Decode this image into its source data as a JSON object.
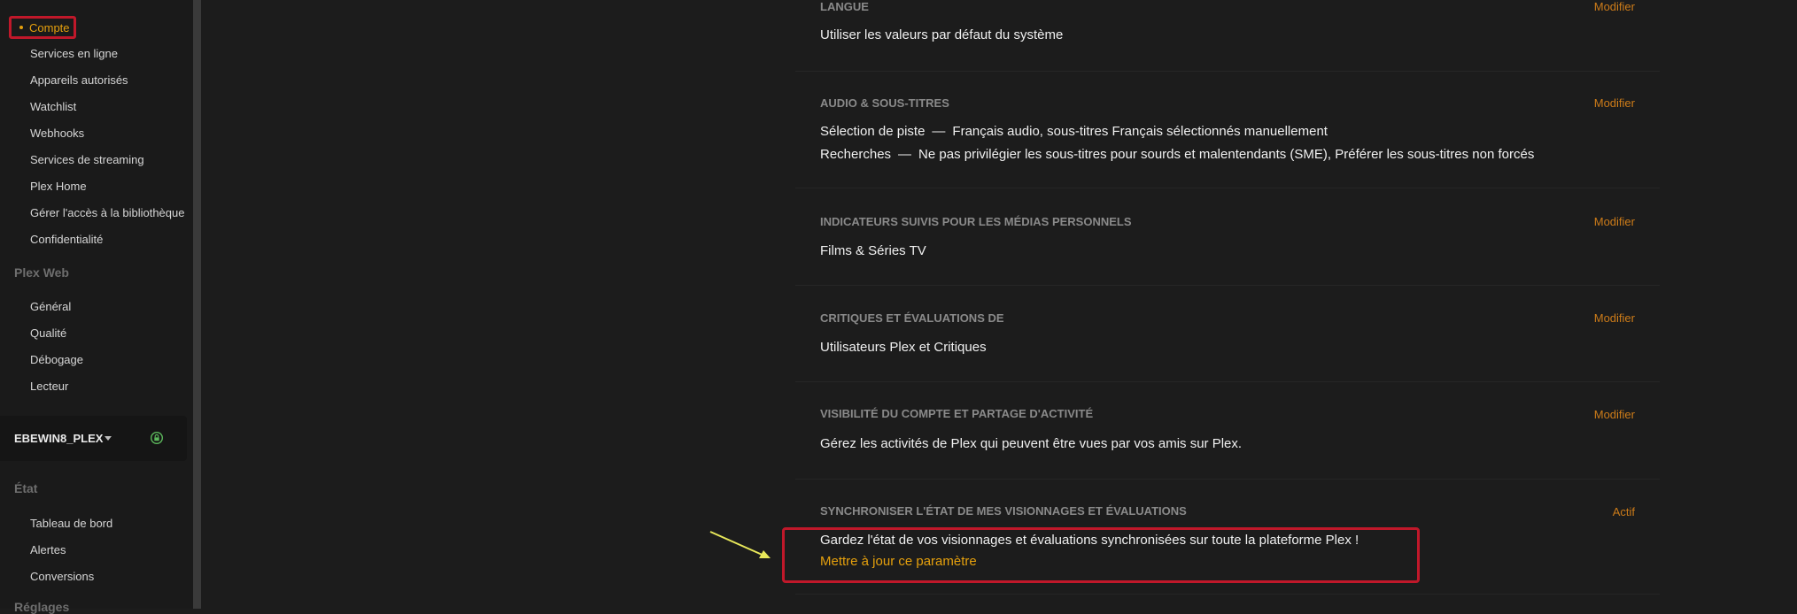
{
  "sidebar": {
    "active_item": "Compte",
    "account_items": [
      "Services en ligne",
      "Appareils autorisés",
      "Watchlist",
      "Webhooks",
      "Services de streaming",
      "Plex Home",
      "Gérer l'accès à la bibliothèque",
      "Confidentialité"
    ],
    "plex_web_heading": "Plex Web",
    "plex_web_items": [
      "Général",
      "Qualité",
      "Débogage",
      "Lecteur"
    ],
    "server_name": "EBEWIN8_PLEX",
    "etat_heading": "État",
    "etat_items": [
      "Tableau de bord",
      "Alertes",
      "Conversions"
    ],
    "reglages_heading": "Réglages"
  },
  "settings": [
    {
      "title": "LANGUE",
      "action": "Modifier",
      "values": [
        {
          "text": "Utiliser les valeurs par défaut du système"
        }
      ]
    },
    {
      "title": "AUDIO & SOUS-TITRES",
      "action": "Modifier",
      "values": [
        {
          "label": "Sélection de piste",
          "text": "Français audio, sous-titres Français sélectionnés manuellement"
        },
        {
          "label": "Recherches",
          "text": "Ne pas privilégier les sous-titres pour sourds et malentendants (SME), Préférer les sous-titres non forcés"
        }
      ]
    },
    {
      "title": "INDICATEURS SUIVIS POUR LES MÉDIAS PERSONNELS",
      "action": "Modifier",
      "values": [
        {
          "text": "Films & Séries TV"
        }
      ]
    },
    {
      "title": "CRITIQUES ET ÉVALUATIONS DE",
      "action": "Modifier",
      "values": [
        {
          "text": "Utilisateurs Plex et Critiques"
        }
      ]
    },
    {
      "title": "VISIBILITÉ DU COMPTE ET PARTAGE D'ACTIVITÉ",
      "action": "Modifier",
      "values": [
        {
          "text": "Gérez les activités de Plex qui peuvent être vues par vos amis sur Plex."
        }
      ]
    },
    {
      "title": "SYNCHRONISER L'ÉTAT DE MES VISIONNAGES ET ÉVALUATIONS",
      "action": "Actif",
      "values": [
        {
          "text": "Gardez l'état de vos visionnages et évaluations synchronisées sur toute la plateforme Plex !"
        }
      ],
      "link": "Mettre à jour ce paramètre"
    }
  ],
  "colors": {
    "accent": "#e5a00d",
    "action": "#cc7b19",
    "highlight_border": "#c0182a",
    "annotation_arrow": "#e8e85a",
    "lock_green": "#5cb85c"
  }
}
